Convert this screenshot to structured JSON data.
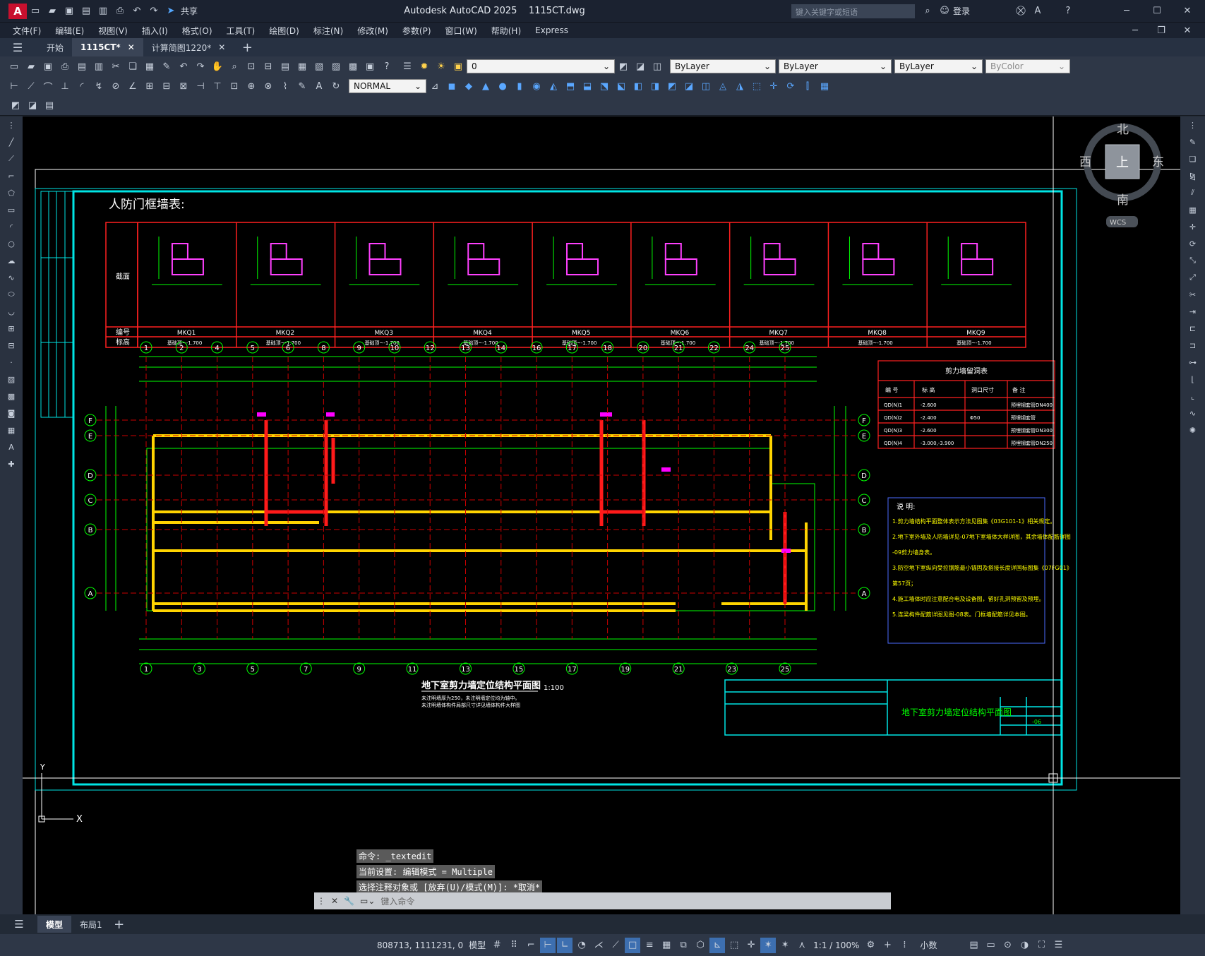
{
  "title_bar": {
    "app_title": "Autodesk AutoCAD 2025",
    "file_name": "1115CT.dwg",
    "share_label": "共享",
    "search_placeholder": "键入关键字或短语",
    "login_label": "登录"
  },
  "menu": [
    "文件(F)",
    "编辑(E)",
    "视图(V)",
    "插入(I)",
    "格式(O)",
    "工具(T)",
    "绘图(D)",
    "标注(N)",
    "修改(M)",
    "参数(P)",
    "窗口(W)",
    "帮助(H)",
    "Express"
  ],
  "tabs": {
    "start": "开始",
    "doc1": "1115CT*",
    "doc2": "计算简图1220*"
  },
  "toolbar": {
    "layer_value": "0",
    "color_value": "ByLayer",
    "linetype_value": "ByLayer",
    "lineweight_value": "ByLayer",
    "plotstyle_value": "ByColor",
    "text_style": "NORMAL"
  },
  "viewcube": {
    "north": "北",
    "south": "南",
    "east": "东",
    "west": "西",
    "top": "上",
    "wcs": "WCS"
  },
  "drawing": {
    "door_table_title": "人防门框墙表:",
    "section_label": "截面",
    "id_label": "编号",
    "elev_label": "标高",
    "door_ids": [
      "MKQ1",
      "MKQ2",
      "MKQ3",
      "MKQ4",
      "MKQ5",
      "MKQ6",
      "MKQ7",
      "MKQ8",
      "MKQ9"
    ],
    "door_elev": "基础顶~-1.700",
    "plan_title": "地下室剪力墙定位结构平面图",
    "plan_scale": "1:100",
    "plan_note1": "未注明墙厚为250，未注明墙定位均为轴中。",
    "plan_note2": "未注明墙体构件局部尺寸详见墙体构件大样图",
    "hole_table_title": "剪力墙留洞表",
    "hole_headers": [
      "编 号",
      "标 高",
      "洞口尺寸",
      "备 注"
    ],
    "hole_rows": [
      [
        "QD(N)1",
        "-2.600",
        "",
        "预埋钢套管DN400"
      ],
      [
        "QD(N)2",
        "-2.400",
        "Φ50",
        "预埋钢套管"
      ],
      [
        "QD(N)3",
        "-2.600",
        "",
        "预埋钢套管DN300"
      ],
      [
        "QD(N)4",
        "-3.000,-3.900",
        "",
        "预埋钢套管DN250"
      ]
    ],
    "notes_title": "说 明:",
    "notes": [
      "1.剪力墙结构平面整体表示方法见图集《03G101-1》相关规定。",
      "2.地下室外墙及人防墙详见-07地下室墙体大样详图，其余墙体配筋详图",
      "-09剪力墙身表。",
      "3.防空地下室纵向受拉钢筋最小锚固及搭接长度详国标图集《07FG01》",
      "第57页；",
      "4.施工墙体时应注意配合电及设备图，留好孔洞预留及预埋。",
      "5.连梁构件配筋详图见图-08表。门框墙配筋详见本图。"
    ],
    "titleblock_name": "地下室剪力墙定位结构平面图",
    "titleblock_no": "-06",
    "axis_top": [
      "1",
      "2",
      "4",
      "5",
      "6",
      "8",
      "9",
      "10",
      "12",
      "13",
      "14",
      "16",
      "17",
      "18",
      "20",
      "21",
      "22",
      "24",
      "25"
    ],
    "axis_bottom": [
      "1",
      "3",
      "5",
      "7",
      "9",
      "11",
      "13",
      "15",
      "17",
      "19",
      "21",
      "23",
      "25"
    ],
    "axis_rows": [
      "F",
      "E",
      "D",
      "C",
      "B",
      "A"
    ]
  },
  "command": {
    "history": [
      "命令: _textedit",
      "当前设置: 编辑模式 = Multiple",
      "选择注释对象或 [放弃(U)/模式(M)]: *取消*"
    ],
    "placeholder": "键入命令"
  },
  "layout_tabs": {
    "model": "模型",
    "layout1": "布局1"
  },
  "status": {
    "coords": "808713, 1111231, 0",
    "model": "模型",
    "scale": "1:1 / 100%",
    "units": "小数"
  }
}
